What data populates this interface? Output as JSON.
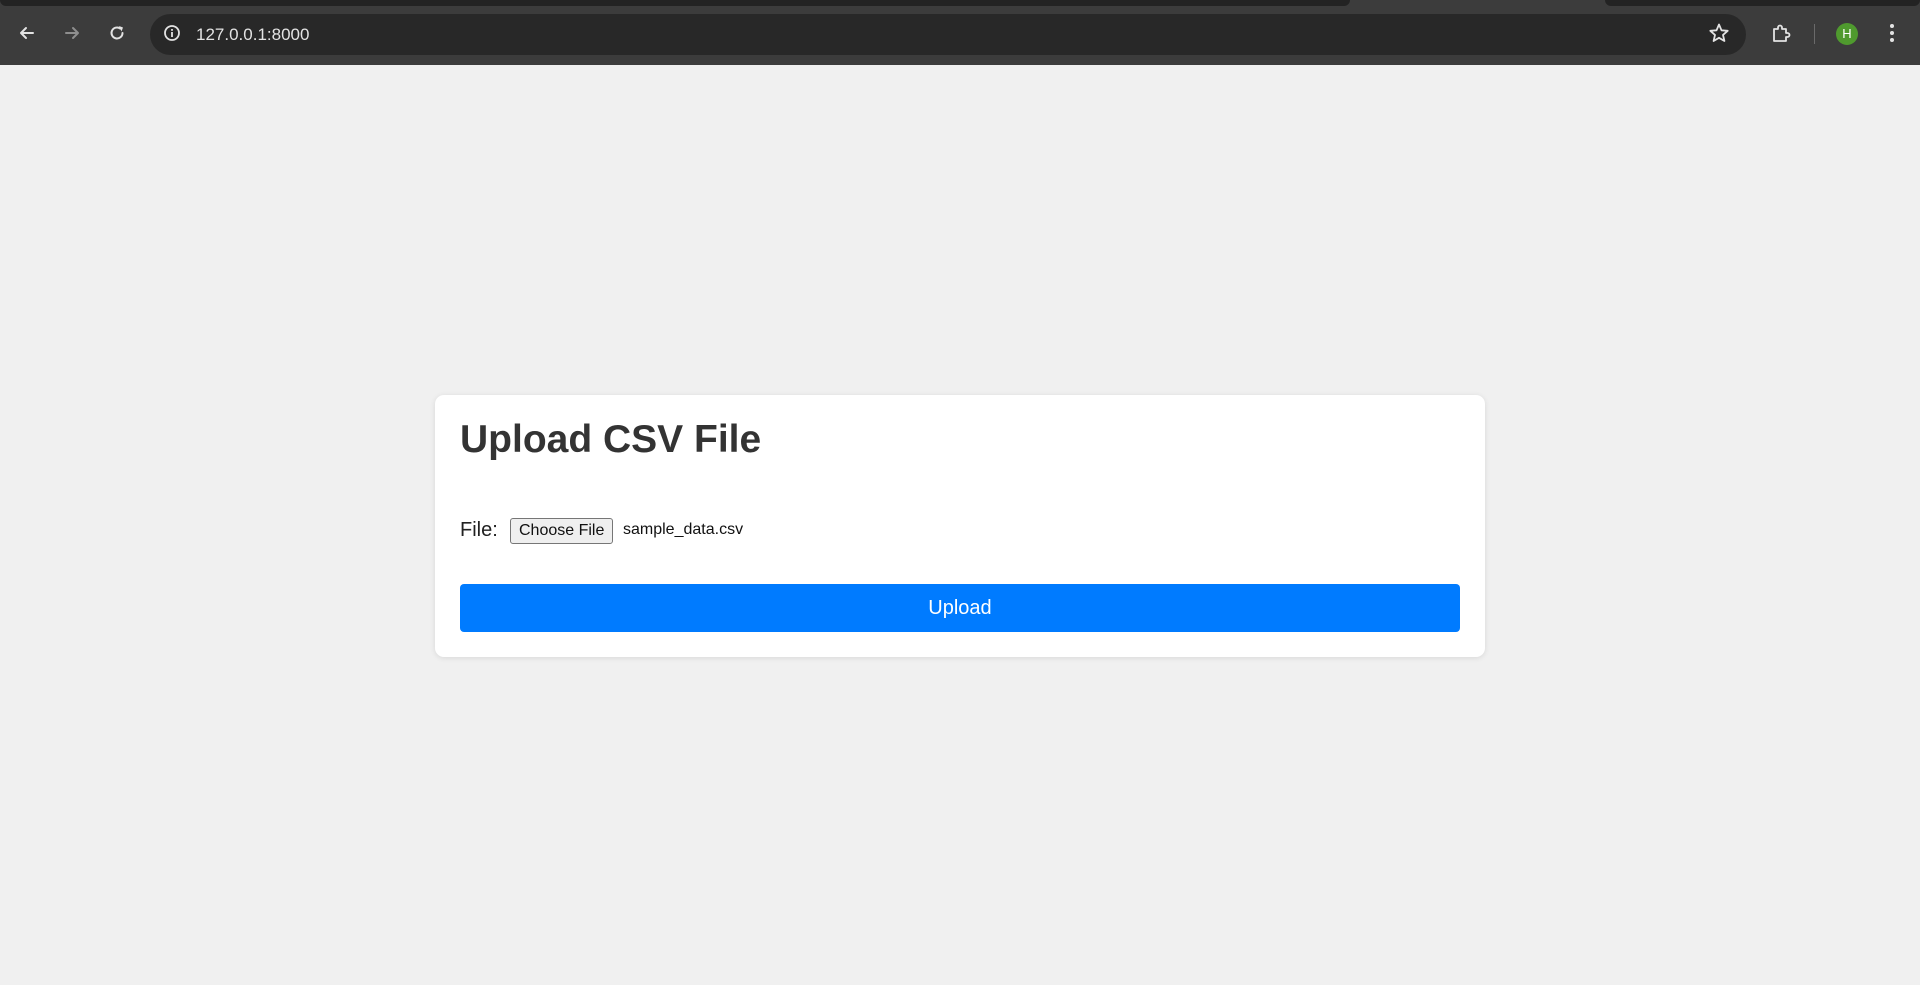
{
  "browser": {
    "url": "127.0.0.1:8000",
    "profile_initial": "H",
    "colors": {
      "toolbar": "#3c3c3c",
      "omnibox": "#282828",
      "avatar": "#4f9a2e"
    },
    "icons": {
      "back": "arrow-left-icon",
      "forward": "arrow-right-icon",
      "reload": "reload-icon",
      "site_info": "info-icon",
      "bookmark": "star-icon",
      "extensions": "puzzle-icon",
      "menu": "kebab-menu-icon"
    }
  },
  "page": {
    "background": "#f0f0f0",
    "title": "Upload CSV File",
    "form": {
      "file_label": "File:",
      "choose_button": "Choose File",
      "selected_file": "sample_data.csv",
      "submit_label": "Upload",
      "submit_color": "#007bff"
    }
  }
}
